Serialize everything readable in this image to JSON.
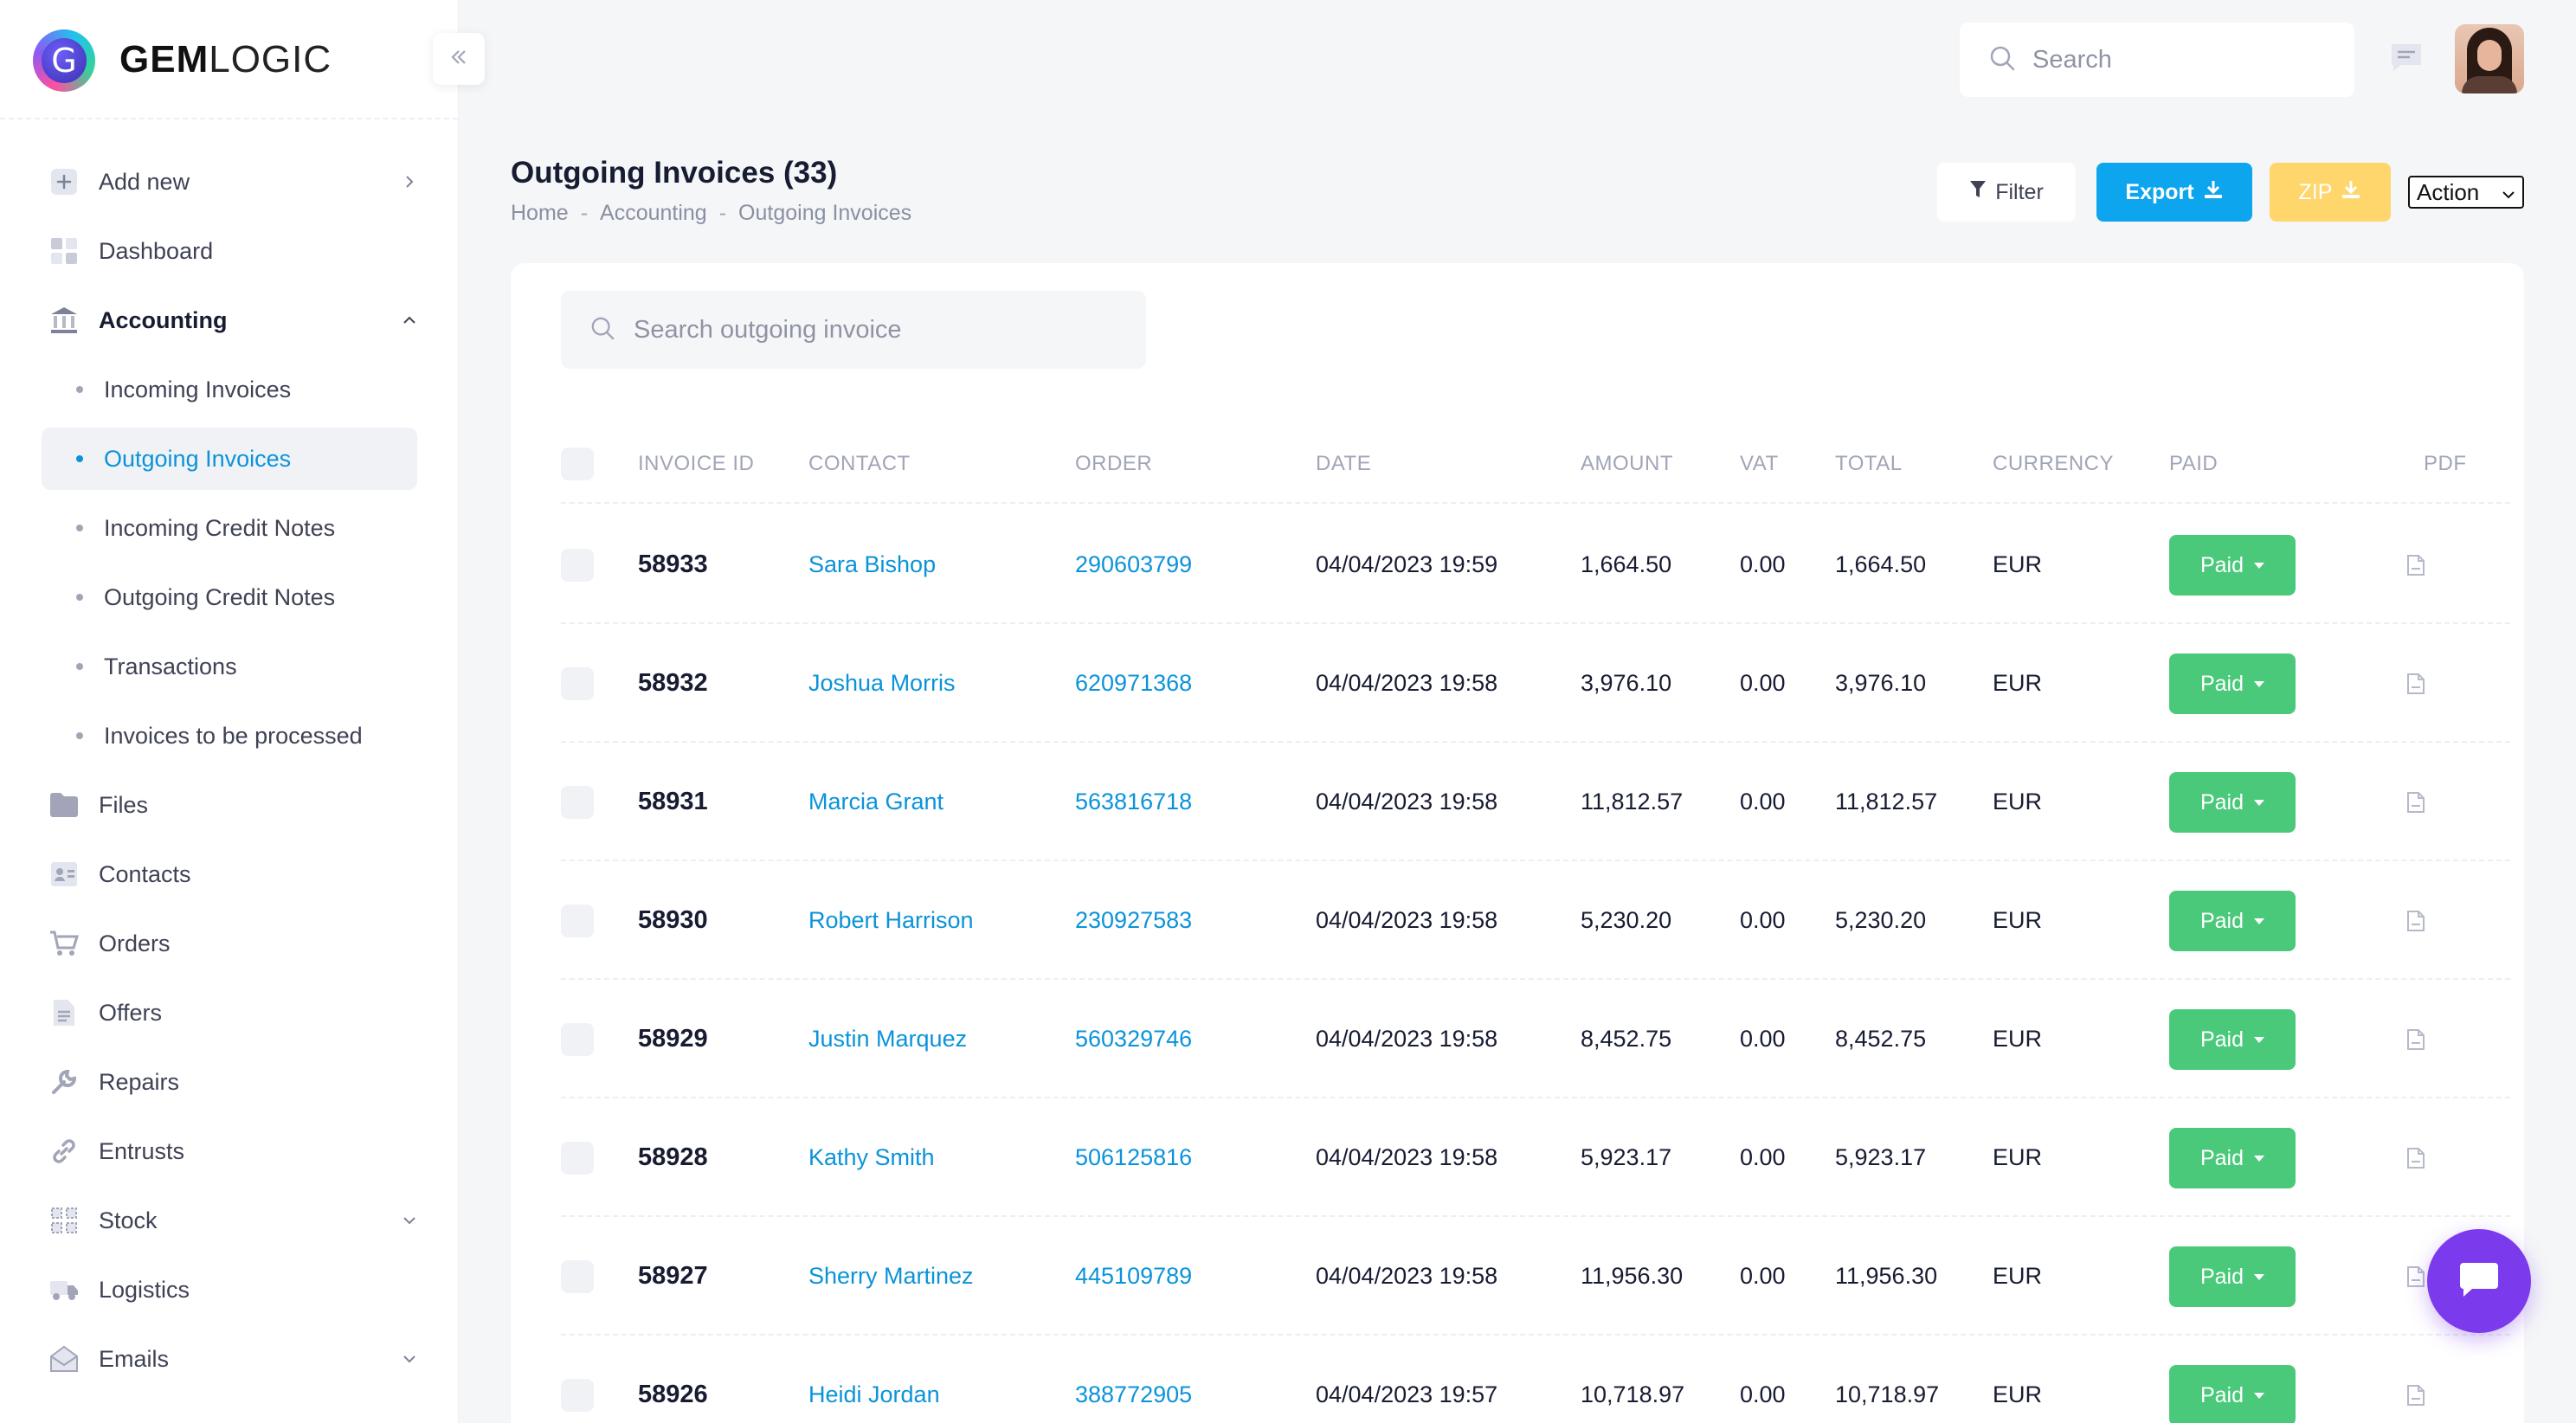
{
  "brand": {
    "logo_letter": "G",
    "name_bold": "GEM",
    "name_rest": "LOGIC"
  },
  "header": {
    "search_placeholder": "Search"
  },
  "sidebar": {
    "add_new": "Add new",
    "dashboard": "Dashboard",
    "accounting": "Accounting",
    "sub_items": [
      "Incoming Invoices",
      "Outgoing Invoices",
      "Incoming Credit Notes",
      "Outgoing Credit Notes",
      "Transactions",
      "Invoices to be processed"
    ],
    "items": [
      "Files",
      "Contacts",
      "Orders",
      "Offers",
      "Repairs",
      "Entrusts",
      "Stock",
      "Logistics",
      "Emails"
    ]
  },
  "page": {
    "title": "Outgoing Invoices (33)",
    "breadcrumb": [
      "Home",
      "Accounting",
      "Outgoing Invoices"
    ],
    "breadcrumb_sep": "-"
  },
  "toolbar": {
    "filter": "Filter",
    "export": "Export",
    "zip": "ZIP",
    "action": "Action"
  },
  "table": {
    "search_placeholder": "Search outgoing invoice",
    "headers": [
      "INVOICE ID",
      "CONTACT",
      "ORDER",
      "DATE",
      "AMOUNT",
      "VAT",
      "TOTAL",
      "CURRENCY",
      "PAID",
      "PDF"
    ],
    "rows": [
      {
        "id": "58933",
        "contact": "Sara Bishop",
        "order": "290603799",
        "date": "04/04/2023 19:59",
        "amount": "1,664.50",
        "vat": "0.00",
        "total": "1,664.50",
        "currency": "EUR",
        "paid": "Paid"
      },
      {
        "id": "58932",
        "contact": "Joshua Morris",
        "order": "620971368",
        "date": "04/04/2023 19:58",
        "amount": "3,976.10",
        "vat": "0.00",
        "total": "3,976.10",
        "currency": "EUR",
        "paid": "Paid"
      },
      {
        "id": "58931",
        "contact": "Marcia Grant",
        "order": "563816718",
        "date": "04/04/2023 19:58",
        "amount": "11,812.57",
        "vat": "0.00",
        "total": "11,812.57",
        "currency": "EUR",
        "paid": "Paid"
      },
      {
        "id": "58930",
        "contact": "Robert Harrison",
        "order": "230927583",
        "date": "04/04/2023 19:58",
        "amount": "5,230.20",
        "vat": "0.00",
        "total": "5,230.20",
        "currency": "EUR",
        "paid": "Paid"
      },
      {
        "id": "58929",
        "contact": "Justin Marquez",
        "order": "560329746",
        "date": "04/04/2023 19:58",
        "amount": "8,452.75",
        "vat": "0.00",
        "total": "8,452.75",
        "currency": "EUR",
        "paid": "Paid"
      },
      {
        "id": "58928",
        "contact": "Kathy Smith",
        "order": "506125816",
        "date": "04/04/2023 19:58",
        "amount": "5,923.17",
        "vat": "0.00",
        "total": "5,923.17",
        "currency": "EUR",
        "paid": "Paid"
      },
      {
        "id": "58927",
        "contact": "Sherry Martinez",
        "order": "445109789",
        "date": "04/04/2023 19:58",
        "amount": "11,956.30",
        "vat": "0.00",
        "total": "11,956.30",
        "currency": "EUR",
        "paid": "Paid"
      },
      {
        "id": "58926",
        "contact": "Heidi Jordan",
        "order": "388772905",
        "date": "04/04/2023 19:57",
        "amount": "10,718.97",
        "vat": "0.00",
        "total": "10,718.97",
        "currency": "EUR",
        "paid": "Paid"
      }
    ]
  },
  "colors": {
    "accent": "#0b93d9",
    "export": "#0ea5ef",
    "zip": "#ffd66b",
    "paid": "#4bc97a",
    "chat": "#7c3aed"
  },
  "icons": {
    "nav": [
      "plus-icon",
      "dashboard-icon",
      "bank-icon",
      "folder-icon",
      "contacts-icon",
      "cart-icon",
      "document-icon",
      "wrench-icon",
      "link-icon",
      "stock-icon",
      "truck-icon",
      "email-icon"
    ],
    "header": [
      "search-icon",
      "message-icon"
    ],
    "fab": "chat-icon"
  }
}
